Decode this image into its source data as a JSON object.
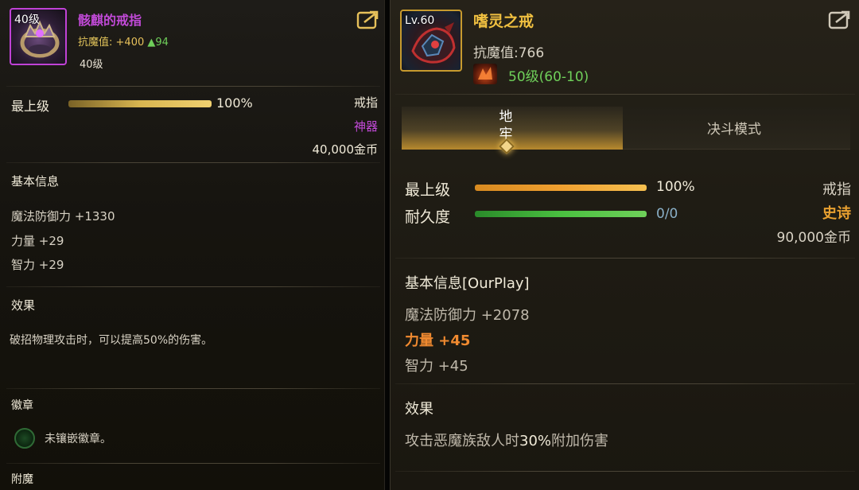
{
  "left_panel": {
    "icon_level": "40级",
    "item_name": "骸麒的戒指",
    "resist_label": "抗魔值:",
    "resist_value": "+400",
    "resist_change": "▲94",
    "level_req": "40级",
    "grade_label": "最上级",
    "grade_percent": "100%",
    "grade_fill": 100,
    "item_type": "戒指",
    "rarity": "神器",
    "price": "40,000金币",
    "basic_info_title": "基本信息",
    "stats": [
      "魔法防御力 +1330",
      "力量 +29",
      "智力 +29"
    ],
    "effect_title": "效果",
    "effect_text": "破招物理攻击时，可以提高50%的伤害。",
    "emblem_title": "徽章",
    "emblem_text": "未镶嵌徽章。",
    "enchant_title": "附魔"
  },
  "right_panel": {
    "icon_level": "Lv.60",
    "item_name": "嗜灵之戒",
    "resist_text": "抗魔值:766",
    "level_range": "50级(60-10)",
    "tabs": [
      {
        "label": "地牢",
        "active": true
      },
      {
        "label": "决斗模式",
        "active": false
      }
    ],
    "grade_label": "最上级",
    "grade_percent": "100%",
    "grade_fill": 100,
    "durability_label": "耐久度",
    "durability_value": "0/0",
    "durability_fill": 100,
    "item_type": "戒指",
    "rarity": "史诗",
    "price": "90,000金币",
    "basic_info_title": "基本信息[OurPlay]",
    "stats": [
      "魔法防御力 +2078",
      "力量 +45",
      "智力 +45"
    ],
    "effect_title": "效果",
    "effect_prefix": "攻击恶魔族敌人时",
    "effect_highlight": "30%",
    "effect_suffix": "附加伤害"
  },
  "colors": {
    "artifact_purple": "#c24ad8",
    "epic_orange": "#e8a030",
    "gold": "#e6c05a",
    "green": "#6fce5a"
  },
  "icons": [
    "share-icon",
    "ring-icon",
    "skill-icon",
    "emblem-slot-icon"
  ]
}
